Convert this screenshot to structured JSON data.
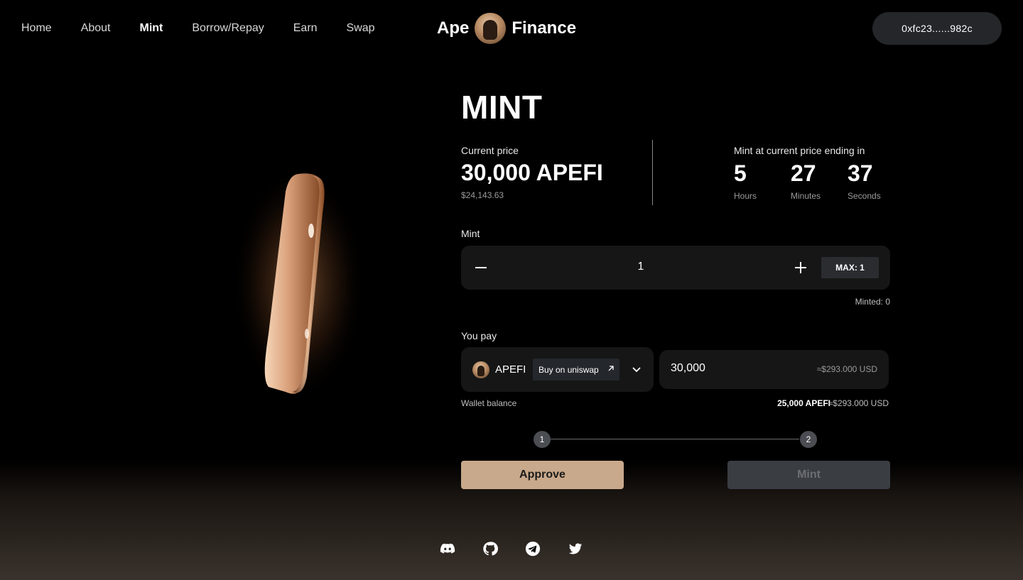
{
  "nav": {
    "items": [
      {
        "label": "Home",
        "active": false
      },
      {
        "label": "About",
        "active": false
      },
      {
        "label": "Mint",
        "active": true
      },
      {
        "label": "Borrow/Repay",
        "active": false
      },
      {
        "label": "Earn",
        "active": false
      },
      {
        "label": "Swap",
        "active": false
      }
    ]
  },
  "logo": {
    "left_word": "Ape",
    "right_word": "Finance"
  },
  "wallet": {
    "address": "0xfc23......982c"
  },
  "page": {
    "title": "MINT"
  },
  "price": {
    "label": "Current price",
    "value": "30,000 APEFI",
    "usd": "$24,143.63"
  },
  "countdown": {
    "label": "Mint at current price ending in",
    "units": [
      {
        "value": "5",
        "unit": "Hours"
      },
      {
        "value": "27",
        "unit": "Minutes"
      },
      {
        "value": "37",
        "unit": "Seconds"
      }
    ]
  },
  "mint": {
    "label": "Mint",
    "quantity": "1",
    "max_label": "MAX: 1",
    "minted": "Minted: 0"
  },
  "pay": {
    "label": "You pay",
    "token": "APEFI",
    "uniswap_label": "Buy on uniswap",
    "amount": "30,000",
    "amount_usd": "≈$293.000 USD",
    "wallet_label": "Wallet balance",
    "wallet_value": "25,000 APEFI",
    "wallet_usd": "≈$293.000 USD"
  },
  "steps": {
    "step1": "1",
    "step2": "2",
    "approve": "Approve",
    "mint": "Mint"
  },
  "social": [
    "discord-icon",
    "github-icon",
    "telegram-icon",
    "twitter-icon"
  ],
  "colors": {
    "accent": "#c9a98b",
    "panel": "#161616",
    "disabled": "#3a3d42"
  }
}
